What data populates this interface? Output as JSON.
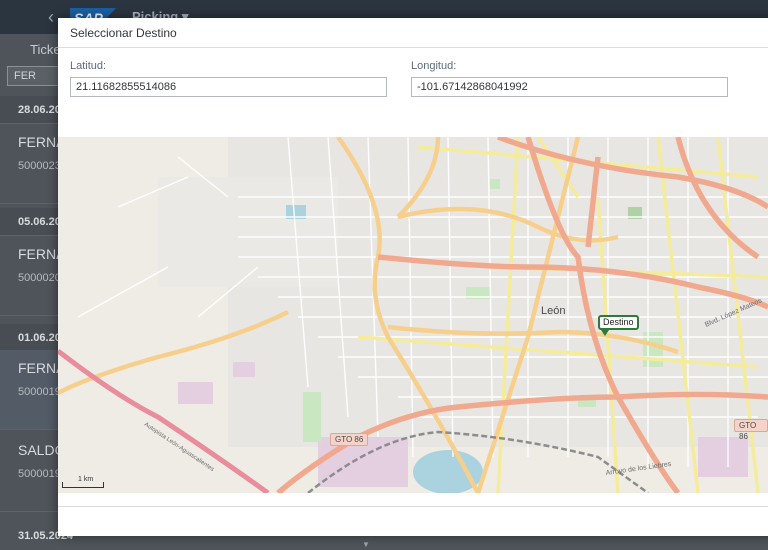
{
  "background": {
    "shell_title": "Picking ▾",
    "logo_text": "SAP",
    "list_header": "Ticke",
    "filter_value": "FER",
    "groups": [
      {
        "date": "28.06.20",
        "name": "FERNA",
        "doc": "5000023"
      },
      {
        "date": "05.06.20",
        "name": "FERNA",
        "doc": "5000020"
      },
      {
        "date": "01.06.20",
        "name": "FERNA",
        "doc": "5000019"
      },
      {
        "date": "",
        "name": "SALDO",
        "doc": "5000019"
      }
    ],
    "footer_date": "31.05.2024"
  },
  "dialog": {
    "title": "Seleccionar Destino",
    "latitude_label": "Latitud:",
    "latitude_value": "21.11682855514086",
    "longitude_label": "Longitud:",
    "longitude_value": "-101.67142868041992"
  },
  "map": {
    "city": "León",
    "marker_label": "Destino",
    "scale_label": "1 km",
    "route_shields": [
      "GTO 86",
      "GTO 86"
    ],
    "street_labels": [
      "Blvd. López Mateos",
      "Arroyo de los Liebres",
      "Autopista León-Aguascalientes"
    ],
    "colors": {
      "land": "#efece6",
      "primary_road": "#f0a98e",
      "secondary_road": "#f6cf8d",
      "tertiary_road": "#f4ec9a",
      "park": "#c9e7c0",
      "water": "#aad3df",
      "industrial": "#e3cfe0"
    }
  }
}
